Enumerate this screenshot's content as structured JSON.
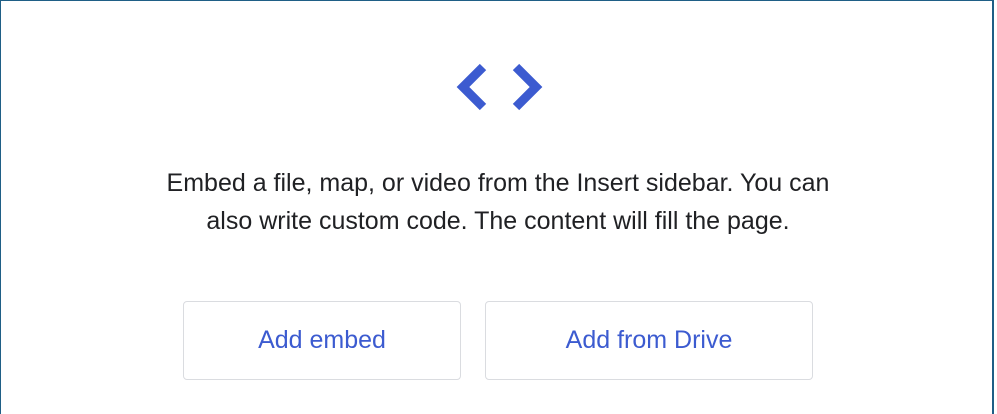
{
  "panel": {
    "icon": "code-brackets-icon",
    "accent_color": "#3c5bd0",
    "message_lines": [
      "Embed a file, map, or video from the Insert sidebar. You can",
      "also write custom code. The content will fill the page."
    ],
    "buttons": {
      "add_embed": "Add embed",
      "add_from_drive": "Add from Drive"
    }
  }
}
